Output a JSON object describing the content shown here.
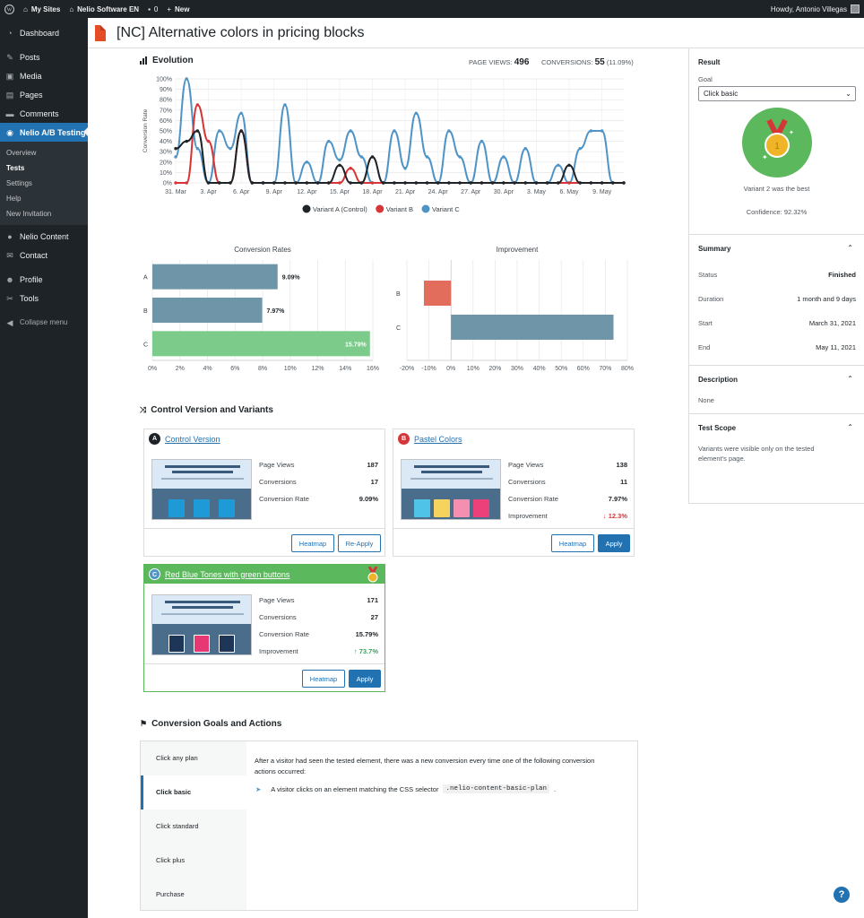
{
  "adminbar": {
    "my_sites": "My Sites",
    "site": "Nelio Software EN",
    "comments": "0",
    "new": "New",
    "howdy": "Howdy, Antonio Villegas"
  },
  "sidebar": {
    "items": [
      {
        "label": "Dashboard",
        "icon": "dashboard-icon"
      },
      {
        "label": "Posts",
        "icon": "pin-icon"
      },
      {
        "label": "Media",
        "icon": "media-icon"
      },
      {
        "label": "Pages",
        "icon": "page-icon"
      },
      {
        "label": "Comments",
        "icon": "comment-icon"
      },
      {
        "label": "Nelio A/B Testing",
        "icon": "nelio-icon"
      },
      {
        "label": "Nelio Content",
        "icon": "circle-icon"
      },
      {
        "label": "Contact",
        "icon": "mail-icon"
      },
      {
        "label": "Profile",
        "icon": "user-icon"
      },
      {
        "label": "Tools",
        "icon": "wrench-icon"
      },
      {
        "label": "Collapse menu",
        "icon": "collapse-icon"
      }
    ],
    "submenu": [
      "Overview",
      "Tests",
      "Settings",
      "Help",
      "New Invitation"
    ]
  },
  "page_title": "[NC] Alternative colors in pricing blocks",
  "evolution": {
    "title": "Evolution",
    "page_views_label": "PAGE VIEWS:",
    "page_views": "496",
    "conversions_label": "CONVERSIONS:",
    "conversions": "55",
    "conversions_pct": "(11.09%)"
  },
  "colors": {
    "a": "#1d2327",
    "b": "#d63638",
    "c": "#4f94c6",
    "bar_a": "#6f95a9",
    "bar_c": "#7ccb8a",
    "imp_b": "#e26d5c",
    "accent": "#2271b1",
    "winner": "#5cb85c"
  },
  "chart_data": [
    {
      "type": "line",
      "title": "",
      "ylabel": "Conversion Rate",
      "ylim": [
        0,
        100
      ],
      "yticks": [
        "0%",
        "10%",
        "20%",
        "30%",
        "40%",
        "50%",
        "60%",
        "70%",
        "80%",
        "90%",
        "100%"
      ],
      "xtick_labels": [
        "31. Mar",
        "3. Apr",
        "6. Apr",
        "9. Apr",
        "12. Apr",
        "15. Apr",
        "18. Apr",
        "21. Apr",
        "24. Apr",
        "27. Apr",
        "30. Apr",
        "3. May",
        "6. May",
        "9. May"
      ],
      "x": [
        "31. Mar",
        "1. Apr",
        "2. Apr",
        "3. Apr",
        "4. Apr",
        "5. Apr",
        "6. Apr",
        "7. Apr",
        "8. Apr",
        "9. Apr",
        "10. Apr",
        "11. Apr",
        "12. Apr",
        "13. Apr",
        "14. Apr",
        "15. Apr",
        "16. Apr",
        "17. Apr",
        "18. Apr",
        "19. Apr",
        "20. Apr",
        "21. Apr",
        "22. Apr",
        "23. Apr",
        "24. Apr",
        "25. Apr",
        "26. Apr",
        "27. Apr",
        "28. Apr",
        "29. Apr",
        "30. Apr",
        "1. May",
        "2. May",
        "3. May",
        "4. May",
        "5. May",
        "6. May",
        "7. May",
        "8. May",
        "9. May",
        "10. May",
        "11. May"
      ],
      "series": [
        {
          "name": "Variant A (Control)",
          "values": [
            33,
            40,
            50,
            0,
            0,
            0,
            50,
            0,
            0,
            0,
            0,
            0,
            0,
            0,
            0,
            17,
            0,
            0,
            25,
            0,
            0,
            0,
            0,
            0,
            0,
            0,
            0,
            0,
            0,
            0,
            0,
            0,
            0,
            0,
            0,
            0,
            17,
            0,
            0,
            0,
            0,
            0
          ]
        },
        {
          "name": "Variant B",
          "values": [
            0,
            0,
            75,
            40,
            0,
            0,
            50,
            0,
            0,
            0,
            0,
            0,
            0,
            0,
            0,
            0,
            14,
            0,
            0,
            0,
            0,
            0,
            0,
            0,
            0,
            0,
            0,
            0,
            0,
            0,
            0,
            0,
            0,
            0,
            0,
            0,
            0,
            0,
            0,
            0,
            0,
            0
          ]
        },
        {
          "name": "Variant C",
          "values": [
            25,
            100,
            33,
            0,
            50,
            33,
            67,
            0,
            0,
            0,
            75,
            0,
            20,
            0,
            40,
            22,
            50,
            25,
            0,
            0,
            50,
            14,
            67,
            25,
            0,
            50,
            25,
            0,
            40,
            0,
            25,
            0,
            33,
            0,
            0,
            17,
            0,
            33,
            50,
            50,
            0,
            0
          ]
        }
      ],
      "legend": "bottom"
    },
    {
      "type": "bar",
      "title": "Conversion Rates",
      "orientation": "horizontal",
      "categories": [
        "A",
        "B",
        "C"
      ],
      "values": [
        9.09,
        7.97,
        15.79
      ],
      "value_labels": [
        "9.09%",
        "7.97%",
        "15.79%"
      ],
      "xlim": [
        0,
        16
      ],
      "xticks": [
        "0%",
        "2%",
        "4%",
        "6%",
        "8%",
        "10%",
        "12%",
        "14%",
        "16%"
      ]
    },
    {
      "type": "bar",
      "title": "Improvement",
      "orientation": "horizontal",
      "categories": [
        "B",
        "C"
      ],
      "values": [
        -12.3,
        73.7
      ],
      "xlim": [
        -20,
        80
      ],
      "xticks": [
        "-20%",
        "-10%",
        "0%",
        "10%",
        "20%",
        "30%",
        "40%",
        "50%",
        "60%",
        "70%",
        "80%"
      ]
    }
  ],
  "variants_title": "Control Version and Variants",
  "variants": [
    {
      "letter": "A",
      "name": "Control Version",
      "rows": [
        {
          "label": "Page Views",
          "value": "187"
        },
        {
          "label": "Conversions",
          "value": "17"
        },
        {
          "label": "Conversion Rate",
          "value": "9.09%"
        }
      ],
      "buttons": [
        "Heatmap",
        "Re-Apply"
      ]
    },
    {
      "letter": "B",
      "name": "Pastel Colors",
      "rows": [
        {
          "label": "Page Views",
          "value": "138"
        },
        {
          "label": "Conversions",
          "value": "11"
        },
        {
          "label": "Conversion Rate",
          "value": "7.97%"
        },
        {
          "label": "Improvement",
          "value": "12.3%"
        }
      ],
      "buttons": [
        "Heatmap",
        "Apply"
      ]
    },
    {
      "letter": "C",
      "name": "Red Blue Tones with green buttons",
      "rows": [
        {
          "label": "Page Views",
          "value": "171"
        },
        {
          "label": "Conversions",
          "value": "27"
        },
        {
          "label": "Conversion Rate",
          "value": "15.79%"
        },
        {
          "label": "Improvement",
          "value": "73.7%"
        }
      ],
      "buttons": [
        "Heatmap",
        "Apply"
      ]
    }
  ],
  "goals": {
    "title": "Conversion Goals and Actions",
    "tabs": [
      "Click any plan",
      "Click basic",
      "Click standard",
      "Click plus",
      "Purchase"
    ],
    "description": "After a visitor had seen the tested element, there was a new conversion every time one of the following conversion actions occurred:",
    "action": "A visitor clicks on an element matching the CSS selector",
    "selector": ".nelio-content-basic-plan",
    "action_end": "."
  },
  "result": {
    "title": "Result",
    "goal_label": "Goal",
    "goal_value": "Click basic",
    "medal_number": "1",
    "best": "Variant 2 was the best",
    "confidence": "Confidence: 92.32%"
  },
  "summary": {
    "title": "Summary",
    "rows": [
      {
        "label": "Status",
        "value": "Finished"
      },
      {
        "label": "Duration",
        "value": "1 month and 9 days"
      },
      {
        "label": "Start",
        "value": "March 31, 2021"
      },
      {
        "label": "End",
        "value": "May 11, 2021"
      }
    ]
  },
  "description": {
    "title": "Description",
    "text": "None"
  },
  "scope": {
    "title": "Test Scope",
    "text": "Variants were visible only on the tested element's page."
  },
  "help": "?"
}
